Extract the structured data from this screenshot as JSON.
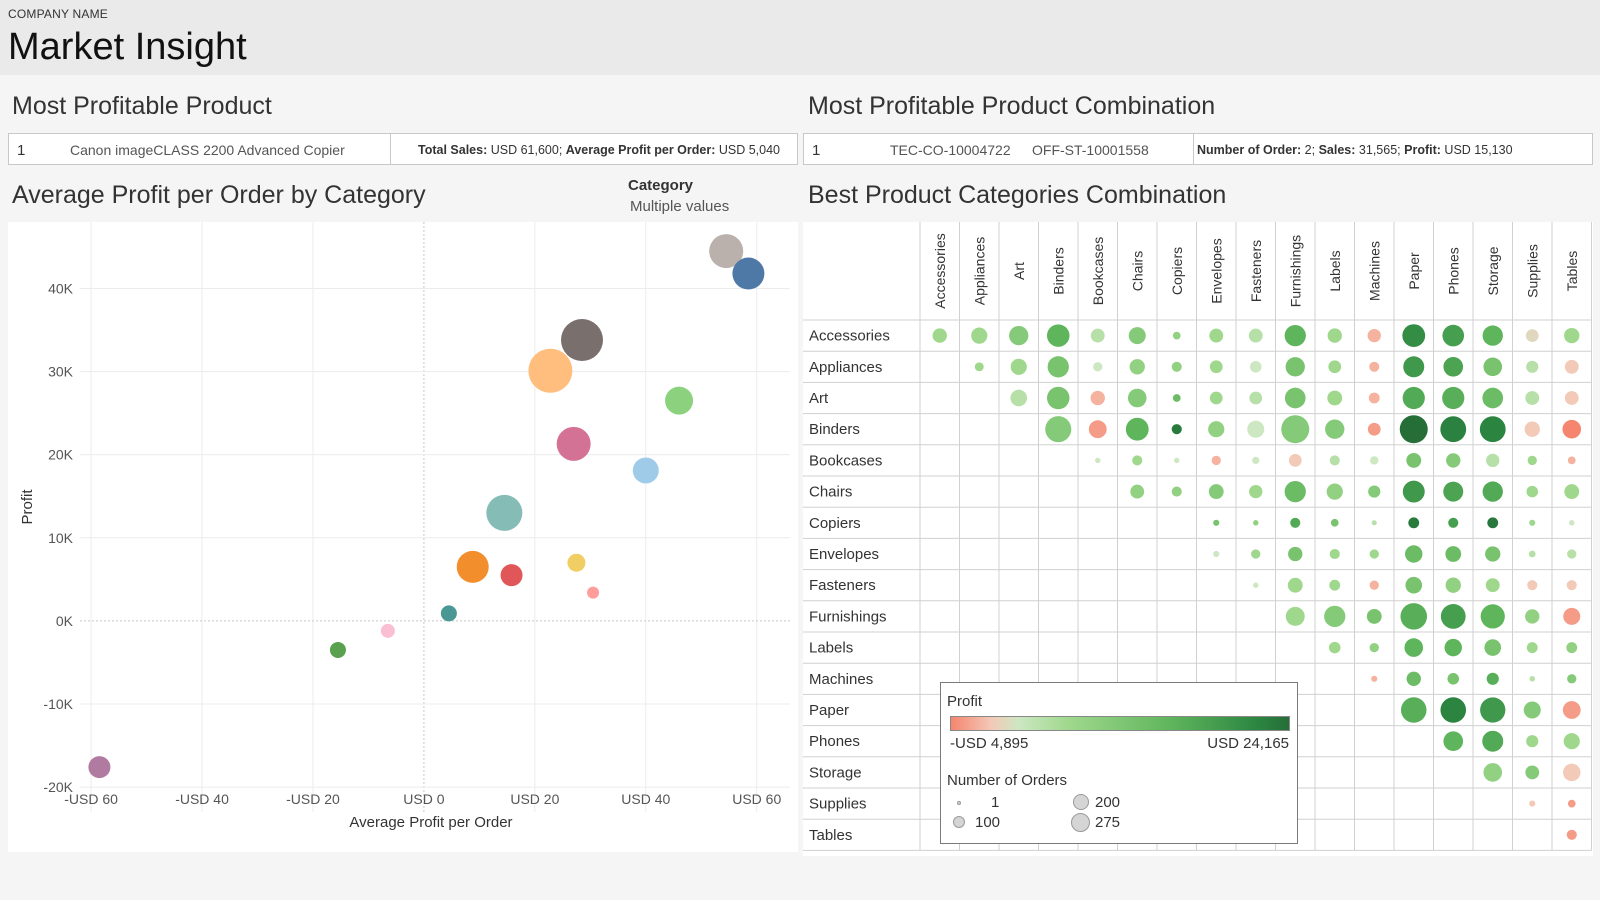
{
  "header": {
    "company": "COMPANY NAME",
    "title": "Market Insight"
  },
  "product": {
    "title": "Most Profitable Product",
    "rank": "1",
    "name": "Canon imageCLASS 2200 Advanced Copier",
    "sales_label": "Total Sales:",
    "sales_value": "USD 61,600;",
    "avg_label": "Average Profit per Order:",
    "avg_value": "USD 5,040"
  },
  "combination": {
    "title": "Most Profitable Product Combination",
    "rank": "1",
    "product_a": "TEC-CO-10004722",
    "product_b": "OFF-ST-10001558",
    "orders_label": "Number of Order:",
    "orders_value": "2;",
    "sales_label": "Sales:",
    "sales_value": "31,565;",
    "profit_label": "Profit:",
    "profit_value": "USD 15,130"
  },
  "scatter_title": "Average Profit per Order by Category",
  "filter": {
    "label": "Category",
    "value": "Multiple values"
  },
  "matrix_title": "Best Product Categories Combination",
  "legend": {
    "profit_title": "Profit",
    "profit_min": "-USD 4,895",
    "profit_max": "USD 24,165",
    "orders_title": "Number of Orders",
    "size_1": "1",
    "size_100": "100",
    "size_200": "200",
    "size_275": "275"
  },
  "chart_data": [
    {
      "type": "scatter",
      "title": "Average Profit per Order by Category",
      "xlabel": "Average Profit per Order",
      "ylabel": "Profit",
      "xlim": [
        -62,
        66
      ],
      "ylim": [
        -23000,
        48000
      ],
      "xticks": [
        -60,
        -40,
        -20,
        0,
        20,
        40,
        60
      ],
      "xtick_labels": [
        "-USD 60",
        "-USD 40",
        "-USD 20",
        "USD 0",
        "USD 20",
        "USD 40",
        "USD 60"
      ],
      "yticks": [
        -20000,
        -10000,
        0,
        10000,
        20000,
        30000,
        40000
      ],
      "ytick_labels": [
        "-20K",
        "-10K",
        "0K",
        "10K",
        "20K",
        "30K",
        "40K"
      ],
      "grid": true,
      "points": [
        {
          "x": 54.5,
          "y": 44500,
          "size": 17,
          "color": "#bab0ac"
        },
        {
          "x": 58.5,
          "y": 41800,
          "size": 16,
          "color": "#4e79a7"
        },
        {
          "x": 28.5,
          "y": 33800,
          "size": 21,
          "color": "#79706e"
        },
        {
          "x": 22.8,
          "y": 30100,
          "size": 22,
          "color": "#ffbe7d"
        },
        {
          "x": 46.0,
          "y": 26500,
          "size": 14,
          "color": "#8cd17d"
        },
        {
          "x": 27.0,
          "y": 21300,
          "size": 17,
          "color": "#d37295"
        },
        {
          "x": 40.0,
          "y": 18100,
          "size": 13,
          "color": "#a0cbe8"
        },
        {
          "x": 14.5,
          "y": 13000,
          "size": 18,
          "color": "#86bcb6"
        },
        {
          "x": 8.8,
          "y": 6500,
          "size": 16,
          "color": "#f28e2b"
        },
        {
          "x": 15.8,
          "y": 5500,
          "size": 11,
          "color": "#e15759"
        },
        {
          "x": 27.5,
          "y": 7000,
          "size": 9,
          "color": "#f1ce63"
        },
        {
          "x": 30.5,
          "y": 3400,
          "size": 6,
          "color": "#ff9d9a"
        },
        {
          "x": 4.5,
          "y": 900,
          "size": 8,
          "color": "#499894"
        },
        {
          "x": -6.5,
          "y": -1200,
          "size": 7,
          "color": "#fabfd2"
        },
        {
          "x": -15.5,
          "y": -3500,
          "size": 8,
          "color": "#59a14f"
        },
        {
          "x": -58.5,
          "y": -17600,
          "size": 11,
          "color": "#b07aa1"
        }
      ]
    },
    {
      "type": "heatmap",
      "title": "Best Product Categories Combination",
      "categories": [
        "Accessories",
        "Appliances",
        "Art",
        "Binders",
        "Bookcases",
        "Chairs",
        "Copiers",
        "Envelopes",
        "Fasteners",
        "Furnishings",
        "Labels",
        "Machines",
        "Paper",
        "Phones",
        "Storage",
        "Supplies",
        "Tables"
      ],
      "color_by": "Profit",
      "size_by": "Number of Orders",
      "color_range": [
        -4895,
        24165
      ],
      "size_range": [
        1,
        275
      ],
      "cells": [
        [
          0,
          0,
          3,
          60
        ],
        [
          0,
          1,
          3,
          80
        ],
        [
          0,
          2,
          5,
          120
        ],
        [
          0,
          3,
          8,
          170
        ],
        [
          0,
          4,
          2,
          55
        ],
        [
          0,
          5,
          5,
          90
        ],
        [
          0,
          6,
          4,
          12
        ],
        [
          0,
          7,
          3,
          55
        ],
        [
          0,
          8,
          2,
          55
        ],
        [
          0,
          9,
          8,
          150
        ],
        [
          0,
          10,
          3,
          60
        ],
        [
          0,
          11,
          -2,
          50
        ],
        [
          0,
          12,
          15,
          175
        ],
        [
          0,
          13,
          12,
          155
        ],
        [
          0,
          14,
          8,
          135
        ],
        [
          0,
          15,
          0,
          45
        ],
        [
          0,
          16,
          3,
          70
        ],
        [
          1,
          1,
          3,
          18
        ],
        [
          1,
          2,
          3,
          80
        ],
        [
          1,
          3,
          6,
          150
        ],
        [
          1,
          4,
          1,
          20
        ],
        [
          1,
          5,
          4,
          70
        ],
        [
          1,
          6,
          4,
          25
        ],
        [
          1,
          7,
          3,
          45
        ],
        [
          1,
          8,
          1,
          35
        ],
        [
          1,
          9,
          6,
          120
        ],
        [
          1,
          10,
          3,
          45
        ],
        [
          1,
          11,
          -2,
          25
        ],
        [
          1,
          12,
          13,
          145
        ],
        [
          1,
          13,
          11,
          125
        ],
        [
          1,
          14,
          6,
          110
        ],
        [
          1,
          15,
          2,
          40
        ],
        [
          1,
          16,
          -1,
          55
        ],
        [
          2,
          2,
          2,
          85
        ],
        [
          2,
          3,
          6,
          170
        ],
        [
          2,
          4,
          -2,
          60
        ],
        [
          2,
          5,
          5,
          110
        ],
        [
          2,
          6,
          7,
          12
        ],
        [
          2,
          7,
          3,
          45
        ],
        [
          2,
          8,
          2,
          45
        ],
        [
          2,
          9,
          6,
          140
        ],
        [
          2,
          10,
          3,
          65
        ],
        [
          2,
          11,
          -2,
          30
        ],
        [
          2,
          12,
          10,
          165
        ],
        [
          2,
          13,
          9,
          165
        ],
        [
          2,
          14,
          7,
          140
        ],
        [
          2,
          15,
          2,
          55
        ],
        [
          2,
          16,
          -1,
          55
        ],
        [
          3,
          3,
          5,
          235
        ],
        [
          3,
          4,
          -3,
          100
        ],
        [
          3,
          5,
          8,
          175
        ],
        [
          3,
          6,
          20,
          25
        ],
        [
          3,
          7,
          4,
          80
        ],
        [
          3,
          8,
          1,
          90
        ],
        [
          3,
          9,
          5,
          275
        ],
        [
          3,
          10,
          5,
          120
        ],
        [
          3,
          11,
          -3,
          45
        ],
        [
          3,
          12,
          24,
          275
        ],
        [
          3,
          13,
          18,
          230
        ],
        [
          3,
          14,
          17,
          230
        ],
        [
          3,
          15,
          -1,
          70
        ],
        [
          3,
          16,
          -4,
          110
        ],
        [
          4,
          4,
          1,
          4
        ],
        [
          4,
          5,
          3,
          25
        ],
        [
          4,
          6,
          1,
          4
        ],
        [
          4,
          7,
          -2,
          20
        ],
        [
          4,
          8,
          1,
          10
        ],
        [
          4,
          9,
          -1,
          45
        ],
        [
          4,
          10,
          2,
          25
        ],
        [
          4,
          11,
          1,
          15
        ],
        [
          4,
          12,
          6,
          65
        ],
        [
          4,
          13,
          5,
          60
        ],
        [
          4,
          14,
          2,
          50
        ],
        [
          4,
          15,
          3,
          20
        ],
        [
          4,
          16,
          -2,
          12
        ],
        [
          5,
          5,
          4,
          55
        ],
        [
          5,
          6,
          4,
          25
        ],
        [
          5,
          7,
          5,
          65
        ],
        [
          5,
          8,
          3,
          50
        ],
        [
          5,
          9,
          7,
          150
        ],
        [
          5,
          10,
          4,
          80
        ],
        [
          5,
          11,
          5,
          40
        ],
        [
          5,
          12,
          13,
          160
        ],
        [
          5,
          13,
          11,
          130
        ],
        [
          5,
          14,
          10,
          135
        ],
        [
          5,
          15,
          3,
          35
        ],
        [
          5,
          16,
          3,
          65
        ],
        [
          6,
          7,
          6,
          6
        ],
        [
          6,
          8,
          4,
          4
        ],
        [
          6,
          9,
          10,
          25
        ],
        [
          6,
          10,
          6,
          12
        ],
        [
          6,
          11,
          2,
          3
        ],
        [
          6,
          12,
          20,
          30
        ],
        [
          6,
          13,
          12,
          25
        ],
        [
          6,
          14,
          21,
          30
        ],
        [
          6,
          15,
          3,
          6
        ],
        [
          6,
          16,
          1,
          4
        ],
        [
          7,
          7,
          1,
          6
        ],
        [
          7,
          8,
          3,
          20
        ],
        [
          7,
          9,
          6,
          60
        ],
        [
          7,
          10,
          3,
          25
        ],
        [
          7,
          11,
          3,
          20
        ],
        [
          7,
          12,
          7,
          95
        ],
        [
          7,
          13,
          7,
          75
        ],
        [
          7,
          14,
          6,
          70
        ],
        [
          7,
          15,
          2,
          8
        ],
        [
          7,
          16,
          2,
          20
        ],
        [
          8,
          8,
          1,
          4
        ],
        [
          8,
          9,
          3,
          65
        ],
        [
          8,
          10,
          3,
          30
        ],
        [
          8,
          11,
          -2,
          20
        ],
        [
          8,
          12,
          6,
          85
        ],
        [
          8,
          13,
          4,
          70
        ],
        [
          8,
          14,
          3,
          55
        ],
        [
          8,
          15,
          -1,
          25
        ],
        [
          8,
          16,
          -1,
          25
        ],
        [
          9,
          9,
          3,
          115
        ],
        [
          9,
          10,
          5,
          150
        ],
        [
          9,
          11,
          6,
          65
        ],
        [
          9,
          12,
          9,
          245
        ],
        [
          9,
          13,
          12,
          210
        ],
        [
          9,
          14,
          8,
          200
        ],
        [
          9,
          15,
          4,
          60
        ],
        [
          9,
          16,
          -3,
          90
        ],
        [
          10,
          10,
          3,
          35
        ],
        [
          10,
          11,
          4,
          20
        ],
        [
          10,
          12,
          8,
          110
        ],
        [
          10,
          13,
          8,
          95
        ],
        [
          10,
          14,
          6,
          85
        ],
        [
          10,
          15,
          3,
          30
        ],
        [
          10,
          16,
          4,
          30
        ],
        [
          11,
          11,
          -2,
          6
        ],
        [
          11,
          12,
          7,
          60
        ],
        [
          11,
          13,
          6,
          35
        ],
        [
          11,
          14,
          9,
          40
        ],
        [
          11,
          15,
          2,
          4
        ],
        [
          11,
          16,
          5,
          20
        ],
        [
          12,
          12,
          9,
          225
        ],
        [
          12,
          13,
          17,
          225
        ],
        [
          12,
          14,
          13,
          220
        ],
        [
          12,
          15,
          5,
          90
        ],
        [
          12,
          16,
          -3,
          100
        ],
        [
          13,
          13,
          8,
          125
        ],
        [
          13,
          14,
          10,
          145
        ],
        [
          13,
          15,
          3,
          40
        ],
        [
          13,
          16,
          3,
          80
        ],
        [
          14,
          14,
          4,
          110
        ],
        [
          14,
          15,
          5,
          55
        ],
        [
          14,
          16,
          -1,
          95
        ],
        [
          15,
          15,
          -1,
          6
        ],
        [
          15,
          16,
          -3,
          12
        ],
        [
          16,
          16,
          -3,
          25
        ]
      ]
    }
  ]
}
